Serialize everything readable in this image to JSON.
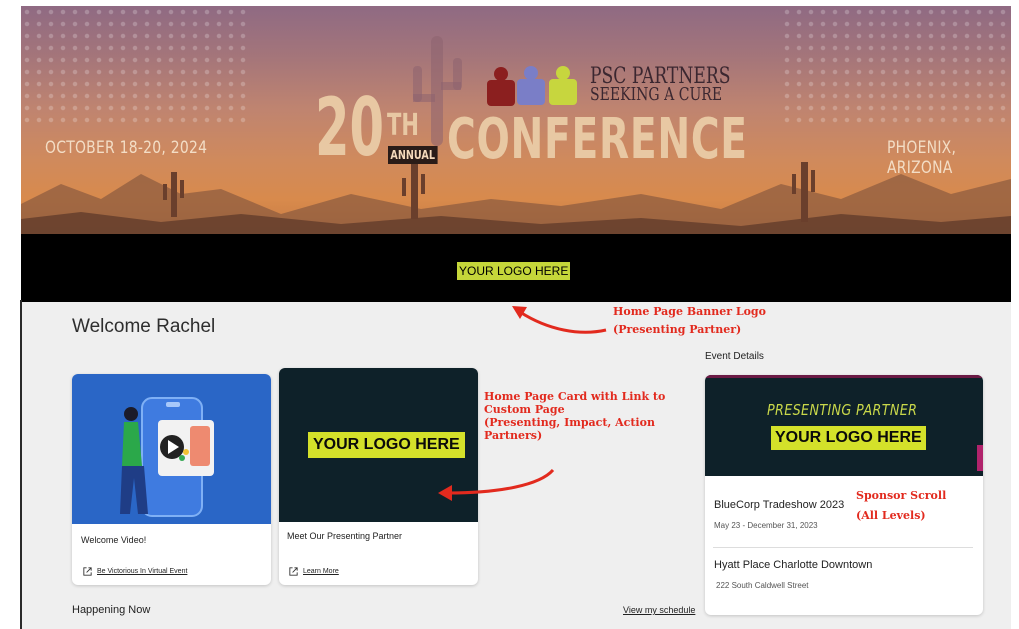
{
  "banner": {
    "dates": "OCTOBER 18-20, 2024",
    "location": "PHOENIX, ARIZONA",
    "number": "20",
    "ordinal": "TH",
    "annual": "ANNUAL",
    "conference": "CONFERENCE",
    "org_line1": "PSC PARTNERS",
    "org_line2": "SEEKING A CURE"
  },
  "logo_bar": {
    "logo_text": "YOUR LOGO HERE"
  },
  "welcome": "Welcome Rachel",
  "cards": [
    {
      "title": "Welcome Video!",
      "link": "Be Victorious In Virtual Event"
    },
    {
      "title": "Meet Our Presenting Partner",
      "link": "Learn More",
      "logo_text": "YOUR LOGO HERE"
    }
  ],
  "happening_now": "Happening Now",
  "view_schedule": "View my schedule",
  "event_details": {
    "heading": "Event Details",
    "sponsor_label": "PRESENTING PARTNER",
    "sponsor_logo": "YOUR LOGO HERE",
    "event_name": "BlueCorp Tradeshow 2023",
    "event_dates": "May 23 - December 31, 2023",
    "venue_name": "Hyatt Place Charlotte Downtown",
    "venue_address": "222 South Caldwell Street"
  },
  "annotations": {
    "banner_logo_1": "Home Page Banner Logo",
    "banner_logo_2": "(Presenting Partner)",
    "card_1": "Home Page Card with Link to",
    "card_2": "Custom Page",
    "card_3": "(Presenting, Impact, Action",
    "card_4": "Partners)",
    "sponsor_1": "Sponsor Scroll",
    "sponsor_2": "(All Levels)"
  },
  "colors": {
    "annotation_red": "#e22a1e",
    "logo_yellow": "#d4e12a",
    "dark_card": "#0e2129",
    "video_blue": "#2a66c6"
  }
}
